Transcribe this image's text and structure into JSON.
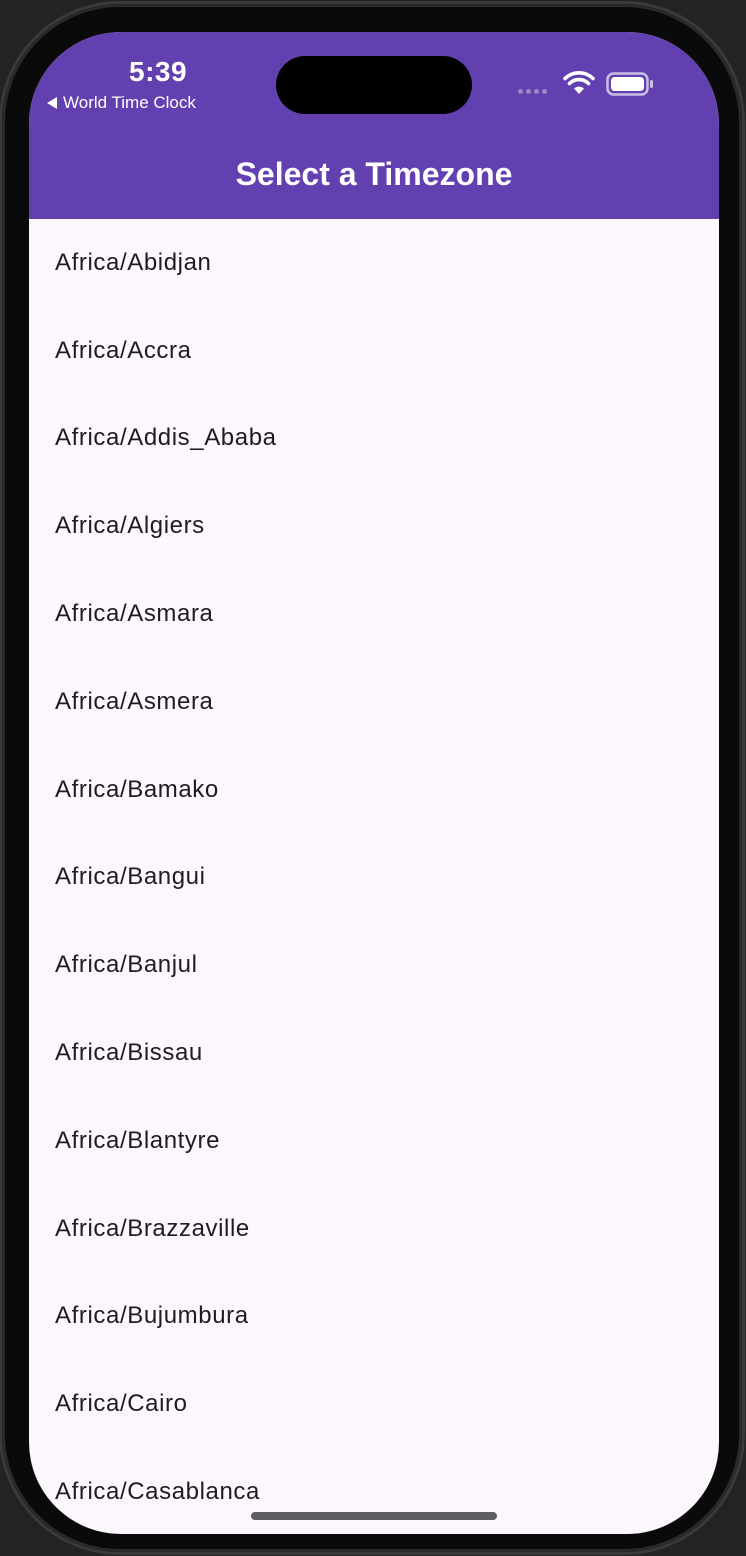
{
  "status_bar": {
    "time": "5:39",
    "back_app": "World Time Clock"
  },
  "app_bar": {
    "title": "Select a Timezone",
    "color": "#6340b0"
  },
  "timezones": [
    "Africa/Abidjan",
    "Africa/Accra",
    "Africa/Addis_Ababa",
    "Africa/Algiers",
    "Africa/Asmara",
    "Africa/Asmera",
    "Africa/Bamako",
    "Africa/Bangui",
    "Africa/Banjul",
    "Africa/Bissau",
    "Africa/Blantyre",
    "Africa/Brazzaville",
    "Africa/Bujumbura",
    "Africa/Cairo",
    "Africa/Casablanca"
  ],
  "icons": {
    "wifi": "wifi-icon",
    "battery": "battery-icon",
    "back": "back-arrow-icon"
  }
}
